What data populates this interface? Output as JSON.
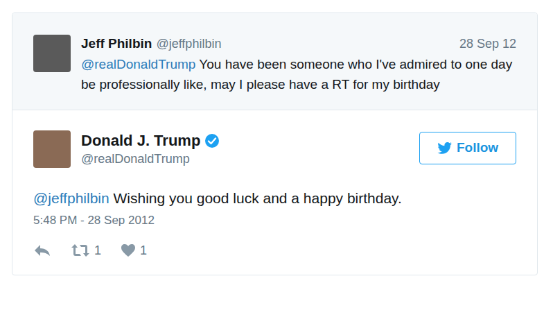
{
  "quoted_tweet": {
    "name": "Jeff Philbin",
    "handle": "@jeffphilbin",
    "date": "28 Sep 12",
    "mention": "@realDonaldTrump",
    "text": "You have been someone who I've admired to one day be professionally like, may I please have a RT for my birthday"
  },
  "tweet": {
    "name": "Donald J. Trump",
    "handle": "@realDonaldTrump",
    "verified": true,
    "follow_button": "Follow",
    "mention": "@jeffphilbin",
    "text": "Wishing you good luck and a happy birthday.",
    "timestamp": "5:48 PM - 28 Sep 2012",
    "actions": [
      {
        "kind": "reply",
        "count": ""
      },
      {
        "kind": "retweet",
        "count": "1"
      },
      {
        "kind": "like",
        "count": "1"
      }
    ]
  }
}
